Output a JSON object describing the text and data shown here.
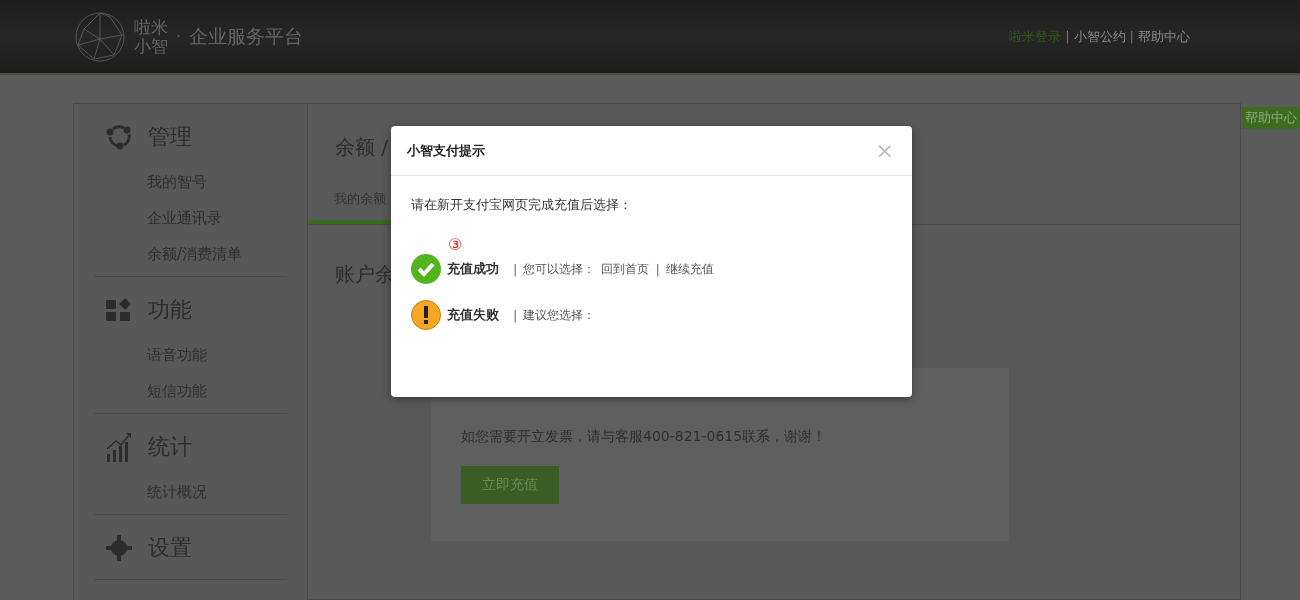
{
  "header": {
    "logo": {
      "line_1": "啦米",
      "line_2": "小智"
    },
    "dot": "·",
    "platform": "企业服务平台",
    "separator": "|",
    "links": [
      {
        "label": "啦米登录",
        "highlighted": true
      },
      {
        "label": "小智公约",
        "highlighted": false
      },
      {
        "label": "帮助中心",
        "highlighted": false
      }
    ]
  },
  "sidebar": {
    "sections": [
      {
        "title": "管理",
        "items": [
          "我的智号",
          "企业通讯录",
          "余额/消费清单"
        ]
      },
      {
        "title": "功能",
        "items": [
          "语音功能",
          "短信功能"
        ]
      },
      {
        "title": "统计",
        "items": [
          "统计概况"
        ]
      },
      {
        "title": "设置"
      }
    ]
  },
  "main": {
    "title": "余额 /",
    "tabs": [
      {
        "label": "我的余额",
        "selected": true
      }
    ],
    "heading": "账户余",
    "notice": "如您需要开立发票，请与客服400-821-0615联系，谢谢！",
    "button": "立即充值"
  },
  "help_tab": "帮助中心",
  "dialog": {
    "title": "小智支付提示",
    "close": "×",
    "prompt": "请在新开支付宝网页完成充值后选择：",
    "step_marker": "③",
    "separator": "|",
    "options": [
      {
        "kind": "success",
        "status": "充值成功",
        "prefix": "您可以选择：",
        "links": [
          "回到首页",
          "继续充值"
        ]
      },
      {
        "kind": "warning",
        "status": "充值失败",
        "prefix": "建议您选择："
      }
    ]
  }
}
